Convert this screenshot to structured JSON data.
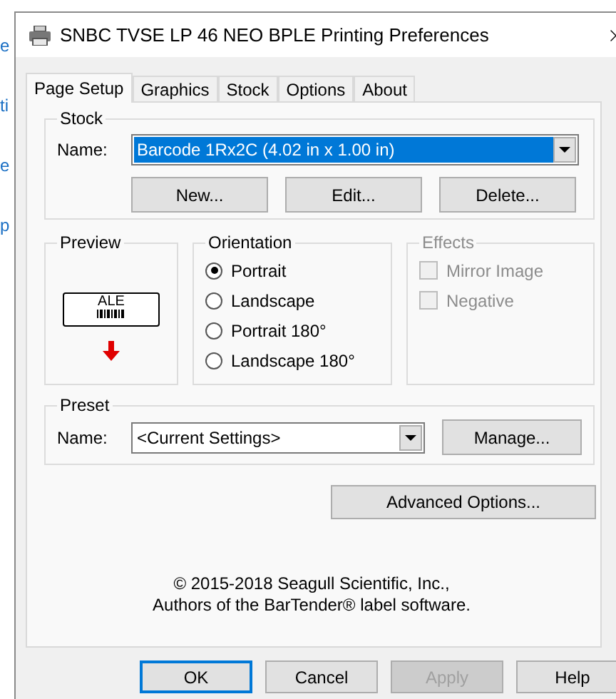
{
  "background_fragments": [
    "e",
    "ti",
    "e",
    "p"
  ],
  "window": {
    "title": "SNBC TVSE LP 46 NEO BPLE Printing Preferences"
  },
  "tabs": [
    {
      "label": "Page Setup",
      "selected": true
    },
    {
      "label": "Graphics",
      "selected": false
    },
    {
      "label": "Stock",
      "selected": false
    },
    {
      "label": "Options",
      "selected": false
    },
    {
      "label": "About",
      "selected": false
    }
  ],
  "stock": {
    "title": "Stock",
    "name_label": "Name:",
    "value": "Barcode 1Rx2C (4.02 in x 1.00 in)",
    "highlighted": true,
    "buttons": [
      "New...",
      "Edit...",
      "Delete..."
    ]
  },
  "preview": {
    "title": "Preview",
    "label_text": "ALE"
  },
  "orientation": {
    "title": "Orientation",
    "options": [
      {
        "label": "Portrait",
        "selected": true
      },
      {
        "label": "Landscape",
        "selected": false
      },
      {
        "label": "Portrait 180°",
        "selected": false
      },
      {
        "label": "Landscape 180°",
        "selected": false
      }
    ]
  },
  "effects": {
    "title": "Effects",
    "disabled": true,
    "options": [
      {
        "label": "Mirror Image",
        "checked": false
      },
      {
        "label": "Negative",
        "checked": false
      }
    ]
  },
  "preset": {
    "title": "Preset",
    "name_label": "Name:",
    "value": "<Current Settings>",
    "highlighted": false,
    "button": "Manage..."
  },
  "advanced_button": "Advanced Options...",
  "copyright": [
    "© 2015-2018 Seagull Scientific, Inc.,",
    "Authors of the BarTender® label software."
  ],
  "footer_buttons": [
    {
      "label": "OK",
      "default": true,
      "disabled": false
    },
    {
      "label": "Cancel",
      "default": false,
      "disabled": false
    },
    {
      "label": "Apply",
      "default": false,
      "disabled": true
    },
    {
      "label": "Help",
      "default": false,
      "disabled": false
    }
  ]
}
